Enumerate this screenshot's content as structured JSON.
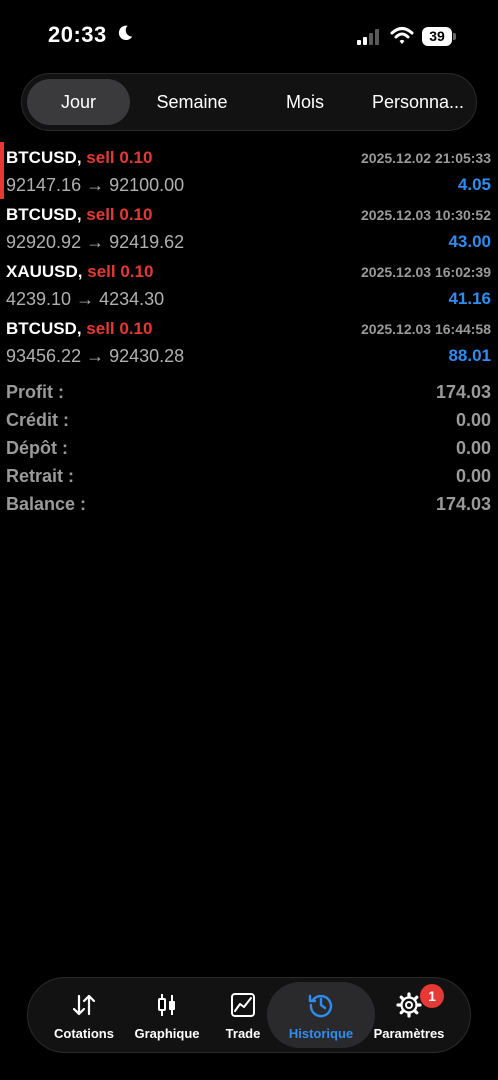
{
  "status_bar": {
    "time": "20:33",
    "battery": "39"
  },
  "tabs": [
    "Jour",
    "Semaine",
    "Mois",
    "Personna..."
  ],
  "trades": [
    {
      "symbol": "BTCUSD,",
      "side": "sell 0.10",
      "datetime": "2025.12.02 21:05:33",
      "prices": "92147.16 → 92100.00",
      "profit": "4.05"
    },
    {
      "symbol": "BTCUSD,",
      "side": "sell 0.10",
      "datetime": "2025.12.03 10:30:52",
      "prices": "92920.92 → 92419.62",
      "profit": "43.00"
    },
    {
      "symbol": "XAUUSD,",
      "side": "sell 0.10",
      "datetime": "2025.12.03 16:02:39",
      "prices": "4239.10 → 4234.30",
      "profit": "41.16"
    },
    {
      "symbol": "BTCUSD,",
      "side": "sell 0.10",
      "datetime": "2025.12.03 16:44:58",
      "prices": "93456.22 → 92430.28",
      "profit": "88.01"
    }
  ],
  "summary": [
    {
      "label": "Profit :",
      "value": "174.03"
    },
    {
      "label": "Crédit :",
      "value": "0.00"
    },
    {
      "label": "Dépôt :",
      "value": "0.00"
    },
    {
      "label": "Retrait :",
      "value": "0.00"
    },
    {
      "label": "Balance :",
      "value": "174.03"
    }
  ],
  "nav": {
    "quotes": "Cotations",
    "chart": "Graphique",
    "trade": "Trade",
    "history": "Historique",
    "settings": "Paramètres",
    "settings_badge": "1"
  },
  "colors": {
    "sell": "#e53935",
    "profit": "#2f8cf0",
    "accent": "#2f8cf0"
  }
}
